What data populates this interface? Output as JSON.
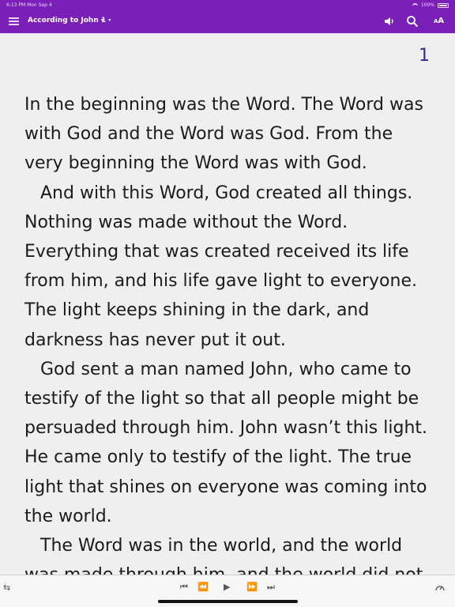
{
  "status_bar": {
    "time": "6:13 PM  Mon Sep 4",
    "battery": "100%"
  },
  "toolbar": {
    "book": "According to John",
    "chapter": "1",
    "caret": "▾",
    "font_label_small": "A",
    "font_label_large": "A"
  },
  "chapter_number": "1",
  "paragraphs": [
    "In the beginning was the Word. The Word was with God and the Word was God. From the very beginning the Word was with God.",
    "And with this Word, God created all things. Nothing was made without the Word. Everything that was created received its life from him, and his life gave light to everyone. The light keeps shining in the dark, and darkness has never put it out.",
    "God sent a man named John, who came to testify of the light so that all people might be persuaded through him. John wasn’t this light. He came only to testify of the light. The true light that shines on everyone was coming into the world.",
    "The Word was in the world, and the world was made through him, and the world did not"
  ],
  "player": {
    "queue": "⇆",
    "skip_back": "⏮",
    "rewind": "⏪",
    "play": "▶",
    "forward": "⏩",
    "skip_forward": "⏭"
  },
  "colors": {
    "toolbar": "#7a1fb8",
    "chapter_number": "#3b2a8c",
    "background": "#efefef"
  }
}
